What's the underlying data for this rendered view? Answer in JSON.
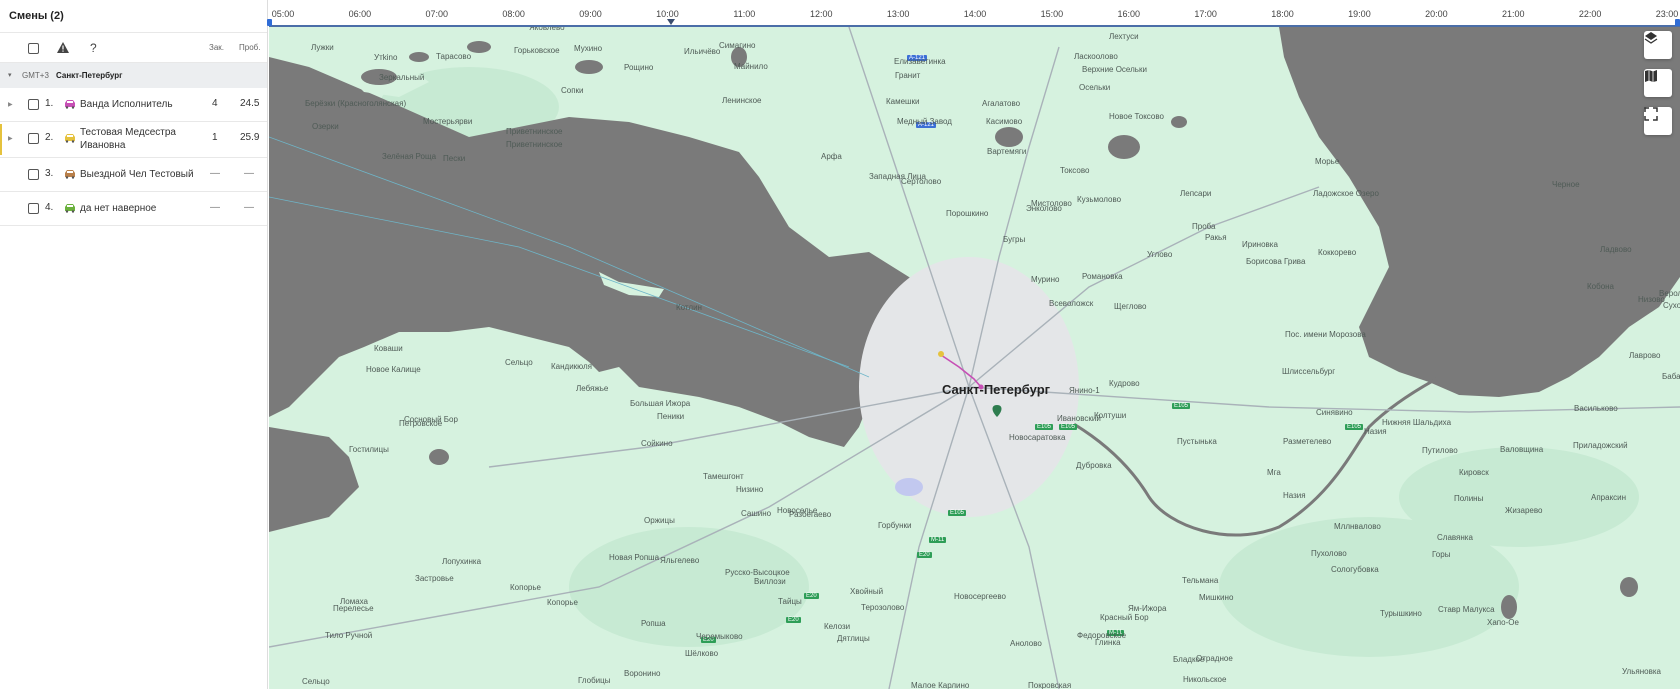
{
  "panel": {
    "title": "Смены (2)",
    "header": {
      "question": "?",
      "col_orders": "Зак.",
      "col_distance": "Проб."
    },
    "group": {
      "timezone": "GMT+3",
      "city": "Санкт-Петербург"
    },
    "rows": [
      {
        "num": "1.",
        "name": "Ванда Исполнитель",
        "orders": "4",
        "distance": "24.5",
        "color": "#c74fb5"
      },
      {
        "num": "2.",
        "name": "Тестовая Медсестра Ивановна",
        "orders": "1",
        "distance": "25.9",
        "color": "#e5c23d"
      },
      {
        "num": "3.",
        "name": "Выездной Чел Тестовый",
        "orders": "—",
        "distance": "—",
        "color": "#b87f4a"
      },
      {
        "num": "4.",
        "name": "да нет наверное",
        "orders": "—",
        "distance": "—",
        "color": "#6bb13d"
      }
    ]
  },
  "timeline": {
    "hours": [
      "05:00",
      "06:00",
      "07:00",
      "08:00",
      "09:00",
      "10:00",
      "11:00",
      "12:00",
      "13:00",
      "14:00",
      "15:00",
      "16:00",
      "17:00",
      "18:00",
      "19:00",
      "20:00",
      "21:00",
      "22:00",
      "23:00"
    ]
  },
  "map": {
    "city_label": "Санкт-Петербург",
    "labels": [
      "Лужки",
      "Яковлево",
      "Горьковское",
      "Мухино",
      "Симагино",
      "Лехтуси",
      "Ильичёво",
      "Елизаветинка",
      "Ласкоолово",
      "Утkino",
      "Тарасово",
      "Рощино",
      "Майнило",
      "Гранит",
      "Верхние Осельки",
      "Зеркальный",
      "Сопки",
      "Ленинское",
      "Камешки",
      "Агалатово",
      "Осельки",
      "Новое Токсово",
      "Берёзки (Красноголянская)",
      "Мостерьярви",
      "Приветнинское",
      "Медный Завод",
      "Касимово",
      "Озерки",
      "Приветнинское",
      "Зелёная Роща",
      "Пески",
      "Арфа",
      "Вартемяги",
      "Токсово",
      "Западная Лица",
      "Сертолово",
      "Мистолово",
      "Кузьмолово",
      "Энколово",
      "Порошкино",
      "Бугры",
      "Мурино",
      "Котлин",
      "Романовка",
      "Всеволожск",
      "Щеглово",
      "Углово",
      "Проба",
      "Ракья",
      "Ириновка",
      "Борисова Грива",
      "Лепсари",
      "Морье",
      "Ладожское Озеро",
      "Коккорево",
      "Черное",
      "Ладвово",
      "Кобона",
      "Низово",
      "Верол",
      "Сухое",
      "Лаврово",
      "Бабаново",
      "Пос. имени Морозова",
      "Шлиссельбург",
      "Синявино",
      "Назия",
      "Нижняя Шальдиха",
      "Васильково",
      "Приладожский",
      "Путилово",
      "Валовщина",
      "Кировск",
      "Разметелево",
      "Колтуши",
      "Янино-1",
      "Кудрово",
      "Ивановский",
      "Новосаратовка",
      "Дубровка",
      "Мга",
      "Мллнвалово",
      "Назия",
      "Полины",
      "Жизарево",
      "Апраксин",
      "Слaвянка",
      "Горы",
      "Пухолово",
      "Сологубовка",
      "Турышкино",
      "Ставр Малукса",
      "Хапо-Ое",
      "Ульяновка",
      "Пустынька",
      "Бладкое",
      "Никольское",
      "Отрадное",
      "Мишкино",
      "Тельмана",
      "Ям-Ижора",
      "Красный Бор",
      "Федоровское",
      "Глинка",
      "Анолово",
      "Покровская",
      "Малое Карлино",
      "Новосергеево",
      "Горбунки",
      "Разбегаево",
      "Новоселье",
      "Сашино",
      "Низино",
      "Тамешгонт",
      "Сойкино",
      "Пеники",
      "Большая Ижора",
      "Лебяжье",
      "Кандикюля",
      "Сельцо",
      "Новое Калище",
      "Ковaши",
      "Сосновый Бор",
      "Петровское",
      "Гостилицы",
      "Оржицы",
      "Новая Ропша",
      "Яльгелево",
      "Русско-Высоцкое",
      "Виллози",
      "Хвойный",
      "Тайцы",
      "Терозолово",
      "Келози",
      "Дятлицы",
      "Черемыково",
      "Шёлково",
      "Ропша",
      "Воронино",
      "Глобицы",
      "Лопухинка",
      "Застровье",
      "Копорье",
      "Копорье",
      "Ломаха",
      "Перелесье",
      "Тило Ручной",
      "Сельцо"
    ]
  }
}
